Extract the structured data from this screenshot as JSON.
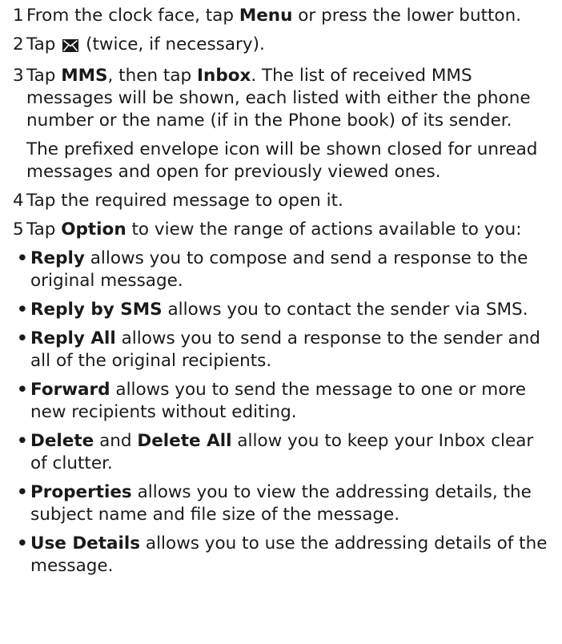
{
  "steps": [
    {
      "num": "1",
      "t1": "From the clock face, tap ",
      "b1": "Menu",
      "t2": " or press the lower button."
    },
    {
      "num": "2",
      "t1": "Tap ",
      "icon": "envelope-icon",
      "t2": " (twice, if necessary)."
    },
    {
      "num": "3",
      "t1": "Tap ",
      "b1": "MMS",
      "t2": ", then tap ",
      "b2": "Inbox",
      "t3": ". The list of received MMS messages will be shown, each listed with either the phone number or the name (if in the Phone book) of its sender.",
      "note": "The prefixed envelope icon will be shown closed for unread messages and open for previously viewed ones."
    },
    {
      "num": "4",
      "t1": "Tap the required message to open it."
    },
    {
      "num": "5",
      "t1": "Tap ",
      "b1": "Option",
      "t2": " to view the range of actions available to you:"
    }
  ],
  "bullet_char": "•",
  "options": [
    {
      "b1": "Reply",
      "t1": " allows you to compose and send a response to the original message."
    },
    {
      "b1": "Reply by SMS",
      "t1": " allows you to contact the sender via SMS."
    },
    {
      "b1": "Reply All",
      "t1": " allows you to send a response to the sender and all of the original recipients."
    },
    {
      "b1": "Forward",
      "t1": " allows you to send the message to one or more new recipients without editing."
    },
    {
      "b1": "Delete",
      "t1": " and ",
      "b2": "Delete All",
      "t2": " allow you to keep your Inbox clear of clutter."
    },
    {
      "b1": "Properties",
      "t1": " allows you to view the addressing details, the subject name and file size of the message."
    },
    {
      "b1": "Use Details",
      "t1": " allows you to use the addressing details of the message."
    }
  ]
}
